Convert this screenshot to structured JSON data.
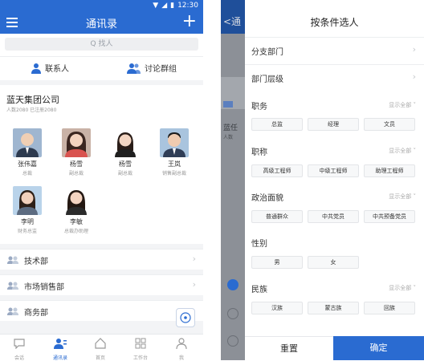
{
  "status_bar": {
    "time": "12:30"
  },
  "contacts": {
    "title": "通讯录",
    "search_placeholder": "Q 找人",
    "tabs": [
      {
        "label": "联系人"
      },
      {
        "label": "讨论群组"
      }
    ],
    "org": {
      "name": "蓝天集团公司",
      "count_text": "人数2080 已注册2080"
    },
    "members": [
      {
        "name": "张伟嘉",
        "role": "总裁"
      },
      {
        "name": "杨雪",
        "role": "副总裁"
      },
      {
        "name": "杨雪",
        "role": "副总裁"
      },
      {
        "name": "王岚",
        "role": "销售副总裁"
      },
      {
        "name": "李明",
        "role": "财务总监"
      },
      {
        "name": "李敏",
        "role": "总裁办助理"
      }
    ],
    "departments": [
      {
        "label": "技术部"
      },
      {
        "label": "市场销售部"
      },
      {
        "label": "商务部"
      }
    ],
    "bottom_nav": [
      {
        "label": "会话",
        "active": false
      },
      {
        "label": "通讯录",
        "active": true
      },
      {
        "label": "首页",
        "active": false
      },
      {
        "label": "工作台",
        "active": false
      },
      {
        "label": "我",
        "active": false
      }
    ]
  },
  "behind_page": {
    "back_text": "<通",
    "org_initial": "蓝任",
    "org_small": "人数",
    "chip_text": "营"
  },
  "filter_panel": {
    "title": "按条件选人",
    "rows": [
      {
        "label": "分支部门"
      },
      {
        "label": "部门层级"
      }
    ],
    "sections": [
      {
        "title": "职务",
        "more": "显示全部",
        "chips": [
          "总监",
          "经理",
          "文员"
        ]
      },
      {
        "title": "职称",
        "more": "显示全部",
        "chips": [
          "高级工程师",
          "中级工程师",
          "助理工程师"
        ]
      },
      {
        "title": "政治面貌",
        "more": "显示全部",
        "chips": [
          "普通群众",
          "中共党员",
          "中共预备党员"
        ]
      },
      {
        "title": "性别",
        "more": "",
        "chips": [
          "男",
          "女"
        ]
      },
      {
        "title": "民族",
        "more": "显示全部",
        "chips": [
          "汉族",
          "蒙古族",
          "回族"
        ]
      }
    ],
    "reset_label": "重置",
    "confirm_label": "确定"
  },
  "colors": {
    "primary": "#2a6bd1",
    "background": "#f3f4f6",
    "overlay": "#8c9097"
  }
}
